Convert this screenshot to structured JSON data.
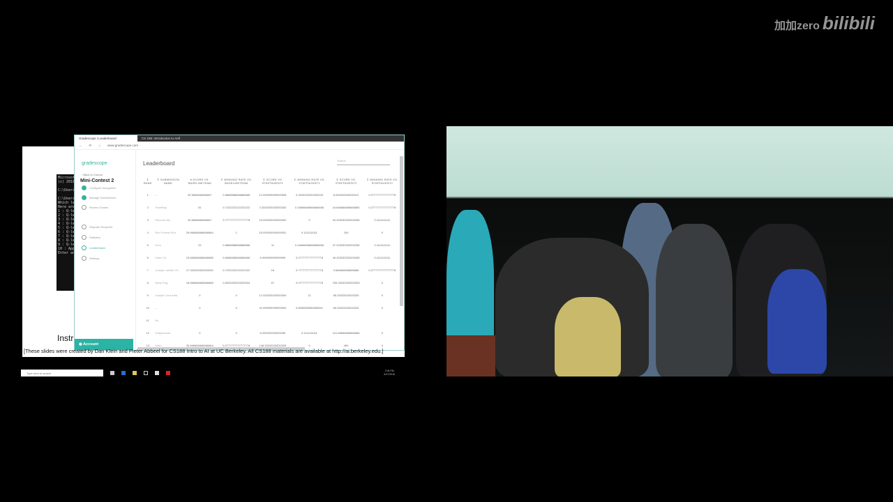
{
  "watermark": {
    "text": "加加zero",
    "brand": "bilibili"
  },
  "slide": {
    "title": "Instr",
    "credits": "[These slides were created by Dan Klein and Pieter Abbeel for CS188 Intro to AI at UC Berkeley.  All CS188 materials are available at http://ai.berkeley.edu.]",
    "terminal": "Microsoft\n(c) 2018\n\nC:\\Users\\\n\nC:\\Users\\\nWhich lec\nHere are\n1 : Q-lea\n2 : Q-lea\n3 : Q-lea\n4 : Q-lea\n5 : Q-lea\n6 : Q-lea\n7 : Q-lea\n8 : Q-lea\n9 : Q-lea\n10 : Appr\nEnter any"
  },
  "browser": {
    "tabs": [
      "Gradescope | Leaderboard",
      "CS 188: Introduction to Artif"
    ],
    "url": "www.gradescope.com"
  },
  "sidebar": {
    "logo": "gradescope",
    "back": "‹ Back to Course",
    "course": "Mini-Contest 2",
    "items": [
      {
        "label": "Configure Autograder",
        "state": "done"
      },
      {
        "label": "Manage Submissions",
        "state": "done"
      },
      {
        "label": "Review Grades",
        "state": "todo"
      },
      {
        "label": "Regrade Requests",
        "state": "icon"
      },
      {
        "label": "Statistics",
        "state": "icon"
      },
      {
        "label": "Leaderboard",
        "state": "selected"
      },
      {
        "label": "Settings",
        "state": "icon"
      }
    ],
    "account": "Account"
  },
  "main": {
    "title": "Leaderboard",
    "search_placeholder": "Search",
    "columns": [
      "⇕ Rank",
      "⇕ Submission Name",
      "▾ Score vs. BaselineTeam",
      "⇕ Winning Rate vs. BaselineTeam",
      "⇕ Score vs. StaffAgent1",
      "⇕ Winning Rate vs. StaffAgent1",
      "⇕ Score vs. StaffAgent2",
      "⇕ Winning Rate vs. StaffAgent2"
    ],
    "rows": [
      [
        "1",
        "—",
        "52.6666666666667",
        "0.8888888888888888",
        "12.999999999999998",
        "0.3333333333333333",
        "8.000000000000012",
        "0.2777777777777778"
      ],
      [
        "2",
        "TeamBoy",
        "51",
        "0.7222222222222222",
        "2.3333333333333332",
        "0.16666666666666666",
        "16.666666666666680",
        "0.2777777777777778"
      ],
      [
        "3",
        "Pacman Wu",
        "40.6666666666667",
        "0.7777777777777778",
        "15.000000000000002",
        "0",
        "40.333333333333336",
        "0.1111111111"
      ],
      [
        "4",
        "Run Forrest Run",
        "29.666666666666664",
        "1",
        "15.000000000000001",
        "0.1111111111",
        "100",
        "0"
      ],
      [
        "5",
        "Hum",
        "23",
        "0.8888888888888888",
        "11",
        "0.16666666666666666",
        "47.333333333333336",
        "0.1111111111"
      ],
      [
        "6",
        "Intern 13",
        "19.666666666666668",
        "0.6666666666666666",
        "6.999999999999999",
        "0.2777777777777778",
        "46.333333333333336",
        "0.1111111111"
      ],
      [
        "7",
        "Joseph Lavelle CS",
        "17.333333333333332",
        "0.7222222222222222",
        "18",
        "0.7777777777777778",
        "9.666666666666666",
        "0.2777777777777778"
      ],
      [
        "8",
        "Neep Pug",
        "16.666666666666668",
        "0.8333333333333334",
        "67",
        "0.2777777777777778",
        "235.33333333333333",
        "0"
      ],
      [
        "9",
        "Joseph Cord data",
        "0",
        "0",
        "12.333333333333334",
        "11",
        "85.33333333333333",
        "0"
      ],
      [
        "10",
        "—",
        "0",
        "0",
        "22.999999999999993",
        "0.5555555555555551",
        "85.33333333333333",
        "0"
      ],
      [
        "11",
        "Hu",
        "",
        "",
        "",
        "",
        "",
        ""
      ],
      [
        "12",
        "Graydonium",
        "0",
        "0",
        "8.333333333333335",
        "0.1111111111",
        "101.66666666666666",
        "0"
      ],
      [
        "13",
        "Hello",
        "33.666666666666664",
        "0.2777777777777778",
        "148.33333333333325",
        "0",
        "400",
        "0"
      ]
    ]
  },
  "taskbar": {
    "search_placeholder": "Type here to search",
    "time": "2:06 PM",
    "date": "6/27/2018"
  },
  "colors": {
    "accent": "#2bb3a4"
  }
}
